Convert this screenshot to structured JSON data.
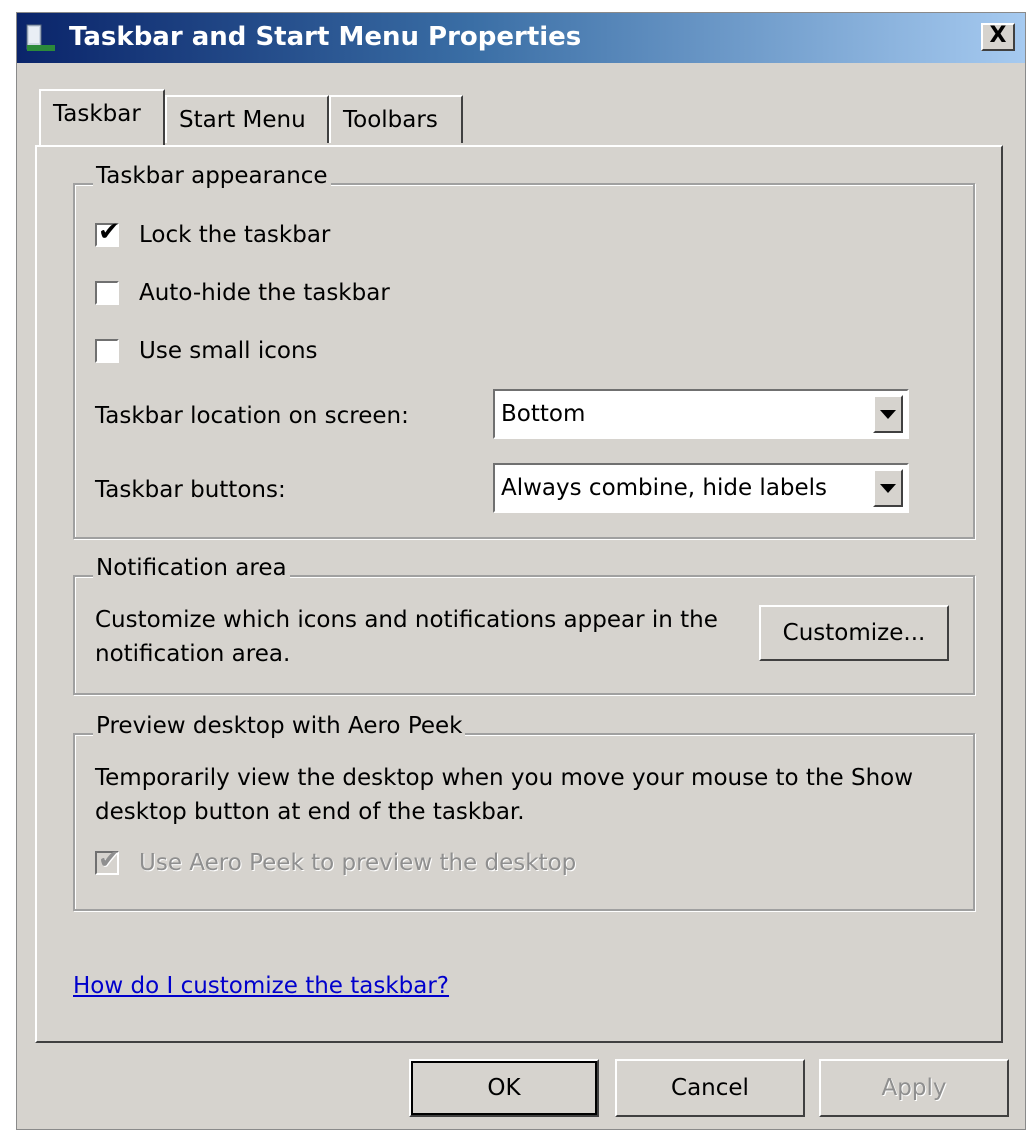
{
  "window": {
    "title": "Taskbar and Start Menu Properties",
    "close_label": "X"
  },
  "tabs": [
    {
      "label": "Taskbar"
    },
    {
      "label": "Start Menu"
    },
    {
      "label": "Toolbars"
    }
  ],
  "appearance": {
    "legend": "Taskbar appearance",
    "lock_label": "Lock the taskbar",
    "lock_checked": true,
    "autohide_label": "Auto-hide the taskbar",
    "autohide_checked": false,
    "small_icons_label": "Use small icons",
    "small_icons_checked": false,
    "location_label": "Taskbar location on screen:",
    "location_value": "Bottom",
    "buttons_label": "Taskbar buttons:",
    "buttons_value": "Always combine, hide labels"
  },
  "notification": {
    "legend": "Notification area",
    "description": "Customize which icons and notifications appear in the notification area.",
    "customize_label": "Customize..."
  },
  "peek": {
    "legend": "Preview desktop with Aero Peek",
    "description": "Temporarily view the desktop when you move your mouse to the Show desktop button at end of the taskbar.",
    "checkbox_label": "Use Aero Peek to preview the desktop",
    "checkbox_checked": true,
    "checkbox_enabled": false
  },
  "help_link": "How do I customize the taskbar?",
  "footer": {
    "ok_label": "OK",
    "cancel_label": "Cancel",
    "apply_label": "Apply"
  },
  "check_glyph": "✔"
}
